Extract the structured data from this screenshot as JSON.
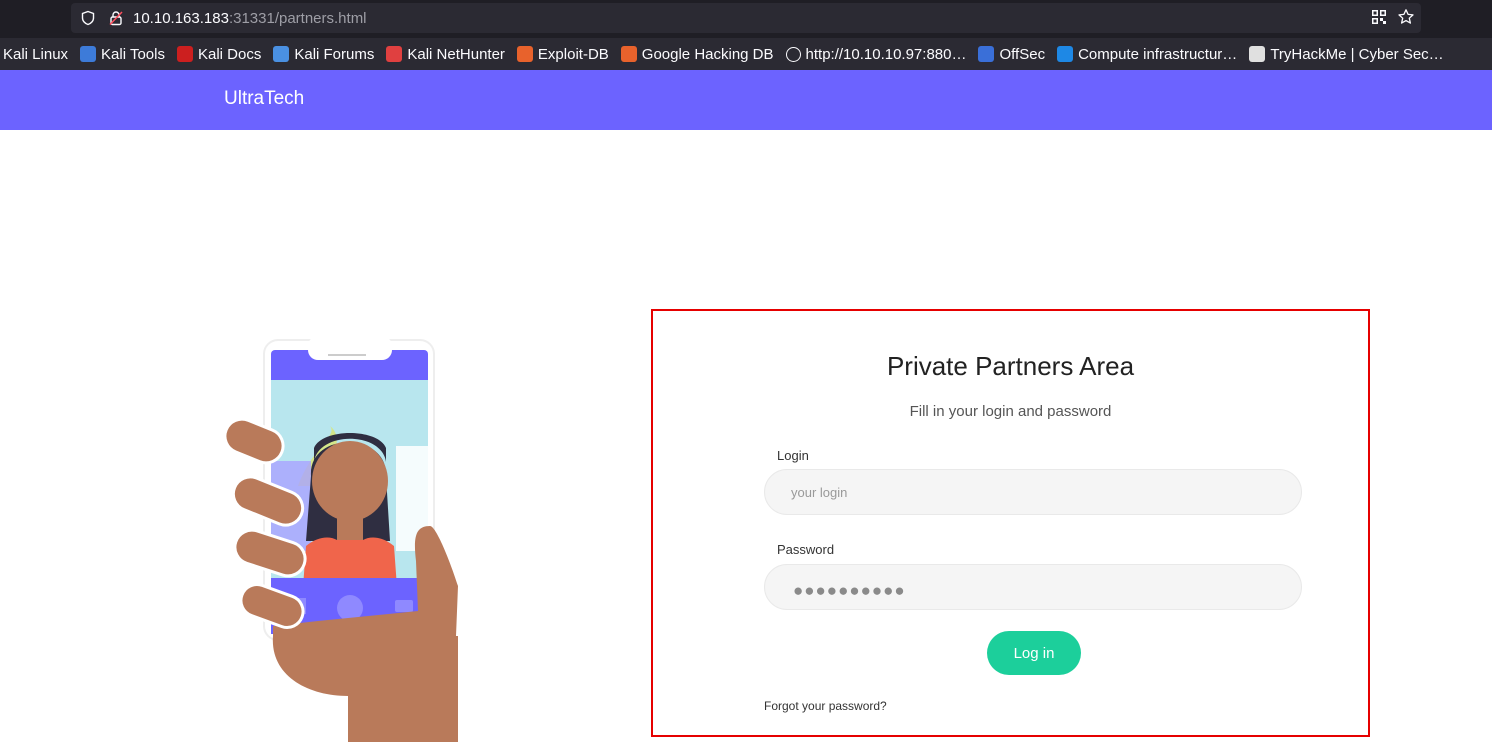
{
  "browser": {
    "url_host": "10.10.163.183",
    "url_rest": ":31331/partners.html",
    "bookmarks": [
      {
        "label": "Kali Linux",
        "icon": "kali-icon",
        "color": "#2b2a33"
      },
      {
        "label": "Kali Tools",
        "icon": "kali-tools-icon",
        "color": "#3d7bd9"
      },
      {
        "label": "Kali Docs",
        "icon": "kali-docs-icon",
        "color": "#cc1f1f"
      },
      {
        "label": "Kali Forums",
        "icon": "kali-forums-icon",
        "color": "#4a90e2"
      },
      {
        "label": "Kali NetHunter",
        "icon": "nethunter-icon",
        "color": "#e04040"
      },
      {
        "label": "Exploit-DB",
        "icon": "exploit-db-icon",
        "color": "#e8622c"
      },
      {
        "label": "Google Hacking DB",
        "icon": "ghdb-icon",
        "color": "#e8622c"
      },
      {
        "label": "http://10.10.10.97:880…",
        "icon": "globe-icon",
        "color": "#2b2a33"
      },
      {
        "label": "OffSec",
        "icon": "offsec-icon",
        "color": "#3a6fd8"
      },
      {
        "label": "Compute infrastructur…",
        "icon": "azure-icon",
        "color": "#1e88e5"
      },
      {
        "label": "TryHackMe | Cyber Sec…",
        "icon": "tryhackme-icon",
        "color": "#e0e0e0"
      }
    ]
  },
  "navbar": {
    "brand": "UltraTech",
    "color": "#6c63ff"
  },
  "login": {
    "title": "Private Partners Area",
    "subtitle": "Fill in your login and password",
    "login_label": "Login",
    "login_placeholder": "your login",
    "password_label": "Password",
    "password_mask": "●●●●●●●●●●",
    "submit_label": "Log in",
    "forgot_label": "Forgot your password?",
    "button_color": "#1ccf9b",
    "highlight_color": "#e60000"
  }
}
